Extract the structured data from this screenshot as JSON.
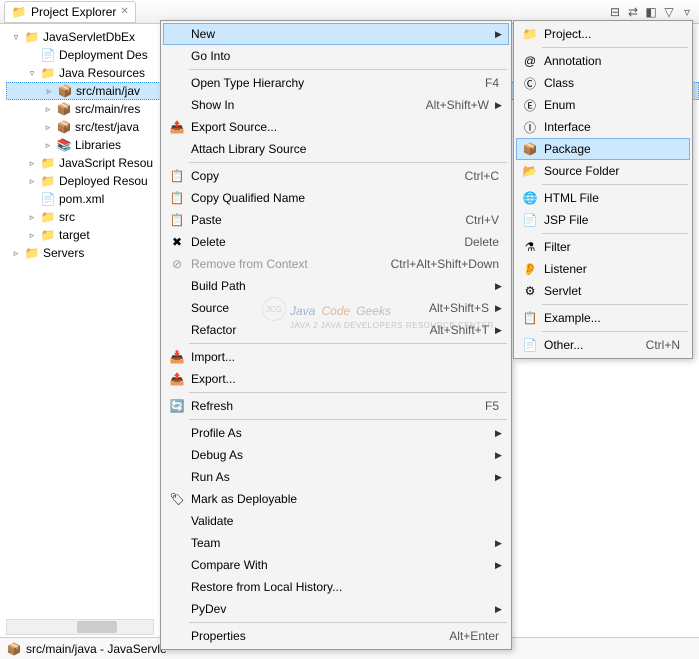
{
  "header": {
    "view_title": "Project Explorer"
  },
  "tree": {
    "items": [
      {
        "indent": 0,
        "arrow": "▿",
        "icon": "📁",
        "iconCls": "folder-blue",
        "label": "JavaServletDbEx"
      },
      {
        "indent": 1,
        "arrow": "",
        "icon": "📄",
        "iconCls": "",
        "label": "Deployment Des"
      },
      {
        "indent": 1,
        "arrow": "▿",
        "icon": "📁",
        "iconCls": "folder-blue",
        "label": "Java Resources"
      },
      {
        "indent": 2,
        "arrow": "▹",
        "icon": "📦",
        "iconCls": "package-icon",
        "label": "src/main/jav",
        "selected": true
      },
      {
        "indent": 2,
        "arrow": "▹",
        "icon": "📦",
        "iconCls": "package-icon",
        "label": "src/main/res"
      },
      {
        "indent": 2,
        "arrow": "▹",
        "icon": "📦",
        "iconCls": "package-icon",
        "label": "src/test/java"
      },
      {
        "indent": 2,
        "arrow": "▹",
        "icon": "📚",
        "iconCls": "",
        "label": "Libraries"
      },
      {
        "indent": 1,
        "arrow": "▹",
        "icon": "📁",
        "iconCls": "folder-yellow",
        "label": "JavaScript Resou"
      },
      {
        "indent": 1,
        "arrow": "▹",
        "icon": "📁",
        "iconCls": "folder-yellow",
        "label": "Deployed Resou"
      },
      {
        "indent": 1,
        "arrow": "",
        "icon": "📄",
        "iconCls": "xml-icon",
        "label": "pom.xml"
      },
      {
        "indent": 1,
        "arrow": "▹",
        "icon": "📁",
        "iconCls": "folder-yellow",
        "label": "src"
      },
      {
        "indent": 1,
        "arrow": "▹",
        "icon": "📁",
        "iconCls": "folder-yellow",
        "label": "target"
      },
      {
        "indent": 0,
        "arrow": "▹",
        "icon": "📁",
        "iconCls": "folder-yellow",
        "label": "Servers"
      }
    ]
  },
  "menu1": [
    {
      "type": "item",
      "icon": "",
      "label": "New",
      "shortcut": "",
      "arrow": true,
      "hover": true
    },
    {
      "type": "item",
      "icon": "",
      "label": "Go Into",
      "shortcut": "",
      "arrow": false
    },
    {
      "type": "sep"
    },
    {
      "type": "item",
      "icon": "",
      "label": "Open Type Hierarchy",
      "shortcut": "F4",
      "arrow": false
    },
    {
      "type": "item",
      "icon": "",
      "label": "Show In",
      "shortcut": "Alt+Shift+W",
      "arrow": true
    },
    {
      "type": "item",
      "icon": "📤",
      "label": "Export Source...",
      "shortcut": "",
      "arrow": false
    },
    {
      "type": "item",
      "icon": "",
      "label": "Attach Library Source",
      "shortcut": "",
      "arrow": false
    },
    {
      "type": "sep"
    },
    {
      "type": "item",
      "icon": "📋",
      "label": "Copy",
      "shortcut": "Ctrl+C",
      "arrow": false
    },
    {
      "type": "item",
      "icon": "📋",
      "label": "Copy Qualified Name",
      "shortcut": "",
      "arrow": false
    },
    {
      "type": "item",
      "icon": "📋",
      "label": "Paste",
      "shortcut": "Ctrl+V",
      "arrow": false
    },
    {
      "type": "item",
      "icon": "✖",
      "label": "Delete",
      "shortcut": "Delete",
      "arrow": false
    },
    {
      "type": "item",
      "icon": "⊘",
      "label": "Remove from Context",
      "shortcut": "Ctrl+Alt+Shift+Down",
      "arrow": false,
      "disabled": true
    },
    {
      "type": "item",
      "icon": "",
      "label": "Build Path",
      "shortcut": "",
      "arrow": true
    },
    {
      "type": "item",
      "icon": "",
      "label": "Source",
      "shortcut": "Alt+Shift+S",
      "arrow": true
    },
    {
      "type": "item",
      "icon": "",
      "label": "Refactor",
      "shortcut": "Alt+Shift+T",
      "arrow": true
    },
    {
      "type": "sep"
    },
    {
      "type": "item",
      "icon": "📥",
      "label": "Import...",
      "shortcut": "",
      "arrow": false
    },
    {
      "type": "item",
      "icon": "📤",
      "label": "Export...",
      "shortcut": "",
      "arrow": false
    },
    {
      "type": "sep"
    },
    {
      "type": "item",
      "icon": "🔄",
      "label": "Refresh",
      "shortcut": "F5",
      "arrow": false
    },
    {
      "type": "sep"
    },
    {
      "type": "item",
      "icon": "",
      "label": "Profile As",
      "shortcut": "",
      "arrow": true
    },
    {
      "type": "item",
      "icon": "",
      "label": "Debug As",
      "shortcut": "",
      "arrow": true
    },
    {
      "type": "item",
      "icon": "",
      "label": "Run As",
      "shortcut": "",
      "arrow": true
    },
    {
      "type": "item",
      "icon": "🏷",
      "label": "Mark as Deployable",
      "shortcut": "",
      "arrow": false
    },
    {
      "type": "item",
      "icon": "",
      "label": "Validate",
      "shortcut": "",
      "arrow": false
    },
    {
      "type": "item",
      "icon": "",
      "label": "Team",
      "shortcut": "",
      "arrow": true
    },
    {
      "type": "item",
      "icon": "",
      "label": "Compare With",
      "shortcut": "",
      "arrow": true
    },
    {
      "type": "item",
      "icon": "",
      "label": "Restore from Local History...",
      "shortcut": "",
      "arrow": false
    },
    {
      "type": "item",
      "icon": "",
      "label": "PyDev",
      "shortcut": "",
      "arrow": true
    },
    {
      "type": "sep"
    },
    {
      "type": "item",
      "icon": "",
      "label": "Properties",
      "shortcut": "Alt+Enter",
      "arrow": false
    }
  ],
  "menu2": [
    {
      "type": "item",
      "icon": "📁",
      "label": "Project...",
      "shortcut": ""
    },
    {
      "type": "sep"
    },
    {
      "type": "item",
      "icon": "@",
      "label": "Annotation",
      "shortcut": ""
    },
    {
      "type": "item",
      "icon": "Ⓒ",
      "label": "Class",
      "shortcut": ""
    },
    {
      "type": "item",
      "icon": "Ⓔ",
      "label": "Enum",
      "shortcut": ""
    },
    {
      "type": "item",
      "icon": "Ⓘ",
      "label": "Interface",
      "shortcut": ""
    },
    {
      "type": "item",
      "icon": "📦",
      "label": "Package",
      "shortcut": "",
      "hover": true
    },
    {
      "type": "item",
      "icon": "📂",
      "label": "Source Folder",
      "shortcut": ""
    },
    {
      "type": "sep"
    },
    {
      "type": "item",
      "icon": "🌐",
      "label": "HTML File",
      "shortcut": ""
    },
    {
      "type": "item",
      "icon": "📄",
      "label": "JSP File",
      "shortcut": ""
    },
    {
      "type": "sep"
    },
    {
      "type": "item",
      "icon": "⚗",
      "label": "Filter",
      "shortcut": ""
    },
    {
      "type": "item",
      "icon": "👂",
      "label": "Listener",
      "shortcut": ""
    },
    {
      "type": "item",
      "icon": "⚙",
      "label": "Servlet",
      "shortcut": ""
    },
    {
      "type": "sep"
    },
    {
      "type": "item",
      "icon": "📋",
      "label": "Example...",
      "shortcut": ""
    },
    {
      "type": "sep"
    },
    {
      "type": "item",
      "icon": "📄",
      "label": "Other...",
      "shortcut": "Ctrl+N"
    }
  ],
  "status": {
    "icon": "📦",
    "text": "src/main/java - JavaServle"
  },
  "watermark": {
    "w1": "Java",
    "w2": "Code",
    "w3": "Geeks",
    "sub": "JAVA 2 JAVA DEVELOPERS RESOURCE CENTER",
    "badge": "JCG"
  }
}
